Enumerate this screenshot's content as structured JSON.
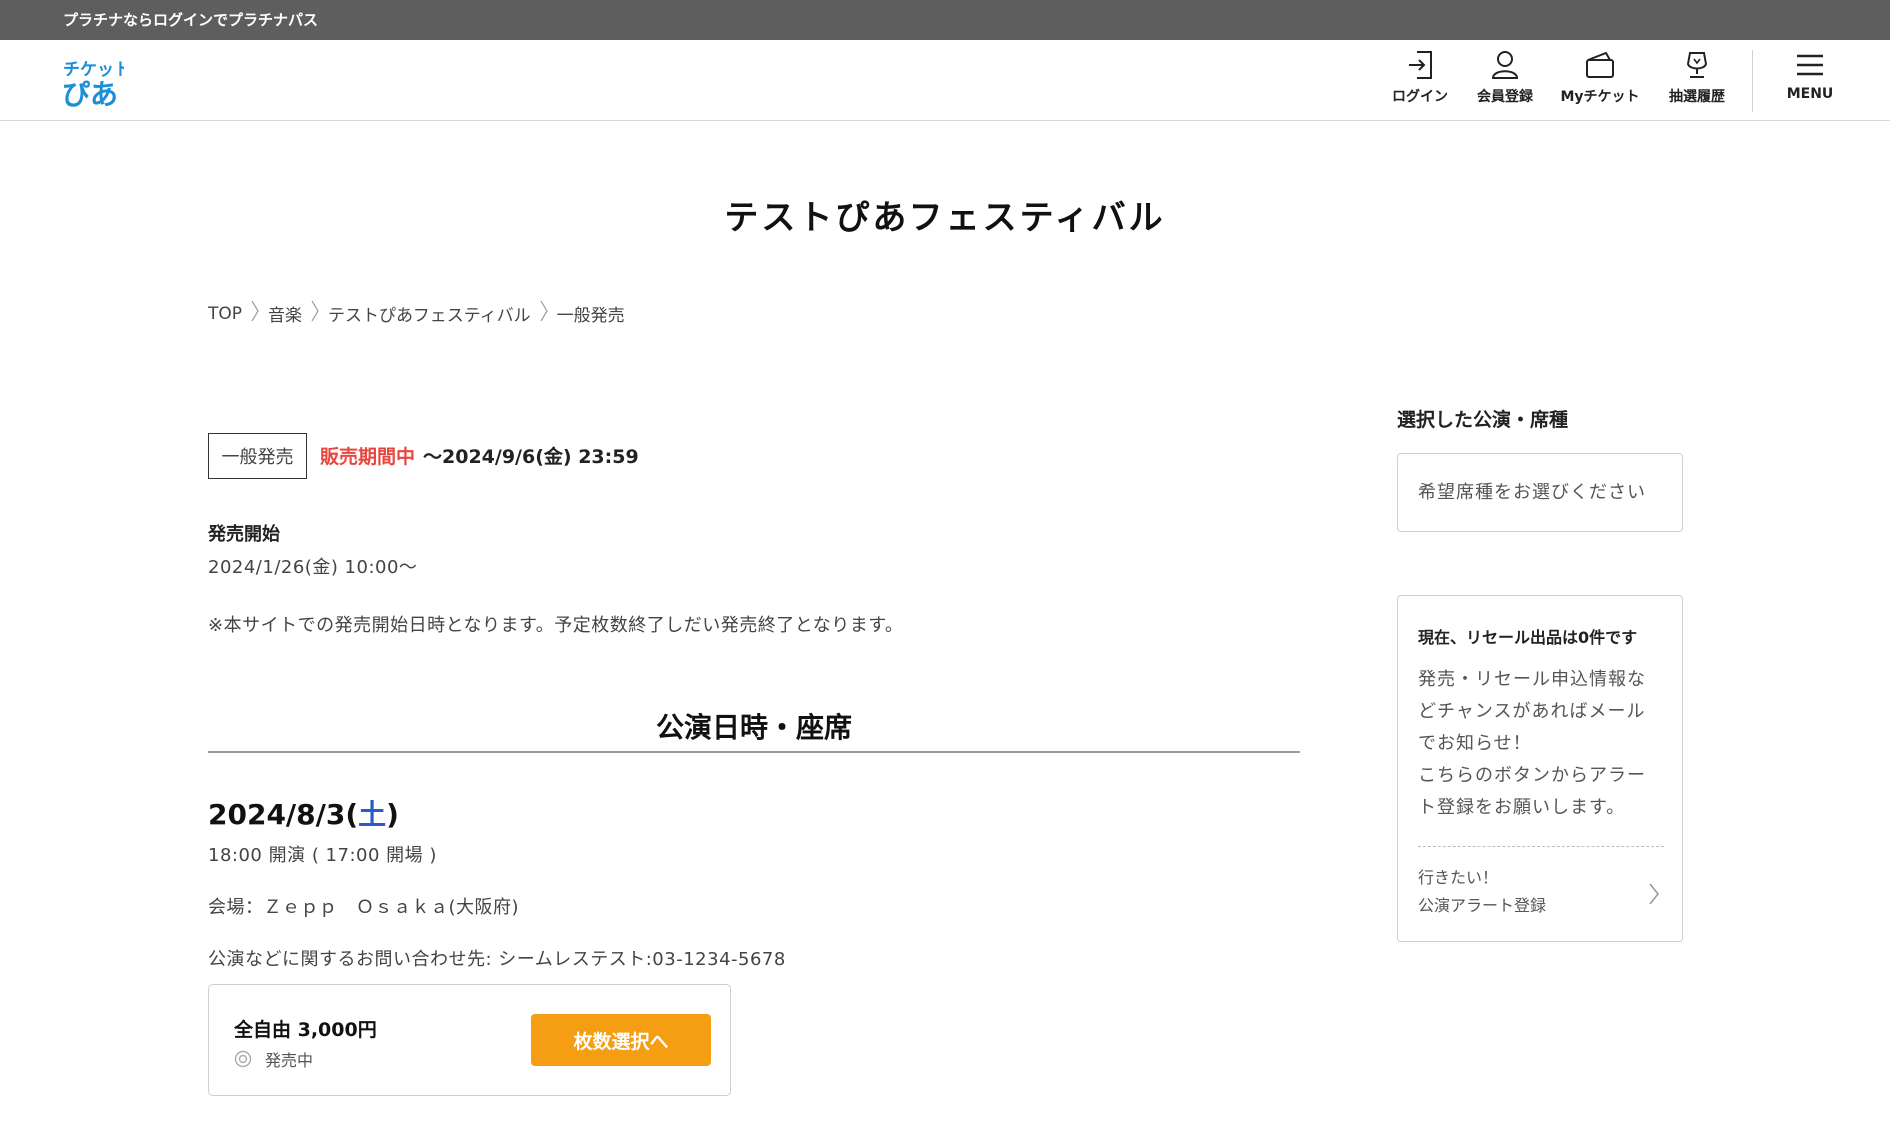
{
  "topbar": {
    "text": "プラチナならログインでプラチナパス"
  },
  "header": {
    "logo_line1": "チケット",
    "logo_line2": "ぴあ",
    "nav": [
      {
        "label": "ログイン",
        "icon": "login-icon"
      },
      {
        "label": "会員登録",
        "icon": "user-icon"
      },
      {
        "label": "Myチケット",
        "icon": "ticket-icon"
      },
      {
        "label": "抽選履歴",
        "icon": "trophy-icon"
      }
    ],
    "menu_label": "MENU"
  },
  "page_title": "テストぴあフェスティバル",
  "breadcrumb": [
    "TOP",
    "音楽",
    "テストぴあフェスティバル",
    "一般発売"
  ],
  "sale": {
    "badge": "一般発売",
    "status": "販売期間中",
    "period": "〜2024/9/6(金) 23:59",
    "start_label": "発売開始",
    "start_value": "2024/1/26(金) 10:00〜",
    "note": "※本サイトでの発売開始日時となります。予定枚数終了しだい発売終了となります。"
  },
  "performance": {
    "section_title": "公演日時・座席",
    "date_main": "2024/8/3(",
    "date_day": "土",
    "date_close": ")",
    "time": "18:00 開演 ( 17:00 開場 )",
    "venue": "会場：Ｚｅｐｐ　Ｏｓａｋａ(大阪府)",
    "contact": "公演などに関するお問い合わせ先: シームレステスト:03-1234-5678"
  },
  "ticket": {
    "name": "全自由 3,000円",
    "status": "発売中",
    "button_label": "枚数選択へ"
  },
  "sidebar": {
    "selected_title": "選択した公演・席種",
    "seat_placeholder": "希望席種をお選びください",
    "resale_title": "現在、リセール出品は0件です",
    "resale_desc": [
      "発売・リセール申込情報な",
      "どチャンスがあればメール",
      "でお知らせ！",
      "こちらのボタンからアラー",
      "ト登録をお願いします。"
    ],
    "alert_line1": "行きたい！",
    "alert_line2": "公演アラート登録"
  },
  "colors": {
    "accent_orange": "#f59d13",
    "sale_red": "#e8473f",
    "saturday_blue": "#2a5cc7",
    "logo_blue": "#1a8fd6",
    "topbar_gray": "#5e5e5e"
  }
}
